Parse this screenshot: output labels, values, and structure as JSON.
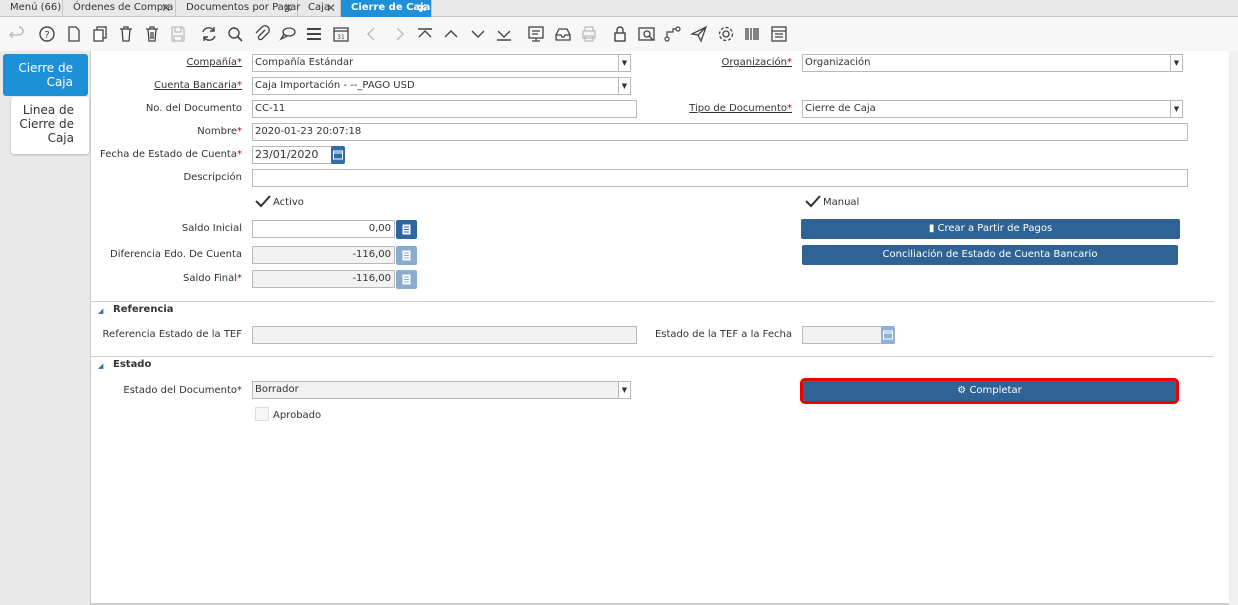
{
  "tabs": [
    {
      "label": "Menú (66)"
    },
    {
      "label": "Órdenes de Compra"
    },
    {
      "label": "Documentos por Pagar"
    },
    {
      "label": "Caja"
    },
    {
      "label": "Cierre de Caja"
    }
  ],
  "toolbar": {
    "icons": [
      "undo-icon",
      "help-icon",
      "new-icon",
      "copy-icon",
      "delete-icon",
      "delete-selection-icon",
      "save-icon",
      "refresh-icon",
      "find-icon",
      "attachment-icon",
      "chat-icon",
      "grid-toggle-icon",
      "calendar-icon",
      "previous-icon",
      "next-icon",
      "first-record-icon",
      "parent-record-icon",
      "detail-record-icon",
      "last-record-icon",
      "report-icon",
      "archive-icon",
      "print-icon",
      "lock-icon",
      "zoom-across-icon",
      "workflow-icon",
      "post-icon",
      "settings-icon",
      "product-info-icon",
      "process-icon"
    ]
  },
  "side_tabs": {
    "active": "Cierre de\nCaja",
    "inactive": "Linea de\nCierre de\nCaja"
  },
  "form": {
    "company": {
      "label": "Compañía",
      "value": "Compañía Estándar"
    },
    "organization": {
      "label": "Organización",
      "value": "Organización"
    },
    "bank_account": {
      "label": "Cuenta Bancaria",
      "value": "Caja Importación - --_PAGO USD"
    },
    "doc_number": {
      "label": "No. del Documento",
      "value": "CC-11"
    },
    "doc_type": {
      "label": "Tipo de Documento",
      "value": "Cierre de Caja"
    },
    "name": {
      "label": "Nombre",
      "value": "2020-01-23 20:07:18"
    },
    "statement_date": {
      "label": "Fecha de Estado de Cuenta",
      "value": "23/01/2020"
    },
    "description": {
      "label": "Descripción",
      "value": ""
    },
    "active": {
      "label": "Activo",
      "checked": true
    },
    "manual": {
      "label": "Manual",
      "checked": true
    },
    "beginning_balance": {
      "label": "Saldo Inicial",
      "value": "0,00"
    },
    "statement_difference": {
      "label": "Diferencia Edo. De Cuenta",
      "value": "-116,00"
    },
    "ending_balance": {
      "label": "Saldo Final",
      "value": "-116,00"
    },
    "create_from_payments": {
      "label": "Crear a Partir de Pagos"
    },
    "bank_reconciliation": {
      "label": "Conciliación de Estado de Cuenta Bancario"
    }
  },
  "reference_section": {
    "title": "Referencia",
    "eft_reference": {
      "label": "Referencia Estado de la TEF",
      "value": ""
    },
    "eft_date": {
      "label": "Estado de la TEF a la Fecha",
      "value": ""
    }
  },
  "status_section": {
    "title": "Estado",
    "doc_status": {
      "label": "Estado del Documento",
      "value": "Borrador"
    },
    "approved": {
      "label": "Aprobado",
      "checked": false
    },
    "complete_button": {
      "label": "Completar"
    }
  },
  "colors": {
    "accent": "#1e90d8",
    "button": "#2f6395",
    "highlight": "#e00000",
    "required": "#cc0000"
  }
}
